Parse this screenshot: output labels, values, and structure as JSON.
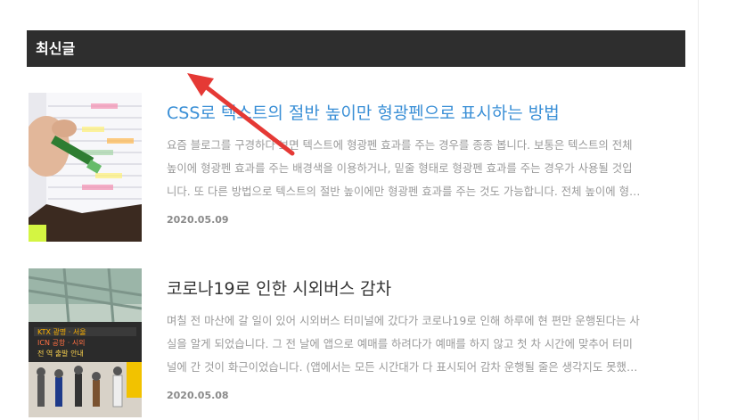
{
  "section": {
    "title": "최신글"
  },
  "posts": [
    {
      "title": "CSS로 텍스트의 절반 높이만 형광펜으로 표시하는 방법",
      "excerpt_lines": [
        "요즘 블로그를 구경하다 보면 텍스트에 형광펜 효과를 주는 경우를 종종 봅니다. 보통은 텍스트의 전체",
        "높이에 형광펜 효과를 주는 배경색을 이용하거나, 밑줄 형태로 형광펜 효과를 주는 경우가 사용될 것입",
        "니다. 또 다른 방법으로 텍스트의 절반 높이에만 형광펜 효과를 주는 것도 가능합니다. 전체 높이에 형…"
      ],
      "date": "2020.05.09",
      "thumbnail_icon": "highlighter-notebook-photo"
    },
    {
      "title": "코로나19로 인한 시외버스 감차",
      "excerpt_lines": [
        "며칠 전 마산에 갈 일이 있어 시외버스 터미널에 갔다가 코로나19로 인해 하루에 현 편만 운행된다는 사",
        "실을 알게 되었습니다. 그 전 날에 앱으로 예매를 하려다가 예매를 하지 않고 첫 차 시간에 맞추어 터미",
        "널에 간 것이 화근이었습니다. (앱에서는 모든 시간대가 다 표시되어 감차 운행될 줄은 생각지도 못했…"
      ],
      "date": "2020.05.08",
      "thumbnail_icon": "bus-terminal-photo"
    }
  ],
  "colors": {
    "header_bg": "#2e2e2e",
    "link_highlight": "#3a8fd6",
    "arrow": "#e53935"
  }
}
